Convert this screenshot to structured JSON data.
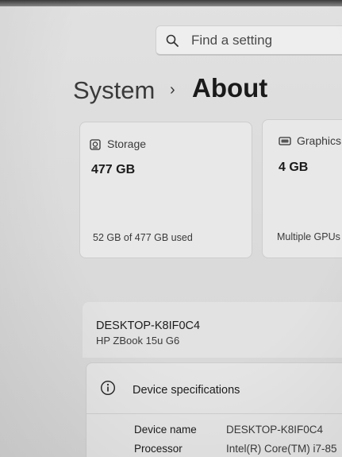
{
  "search": {
    "placeholder": "Find a setting"
  },
  "breadcrumb": {
    "parent": "System",
    "separator": "›",
    "current": "About"
  },
  "cards": {
    "storage": {
      "title": "Storage",
      "value": "477 GB",
      "usage": "52 GB of 477 GB used",
      "icon": "storage-drive-icon"
    },
    "graphics": {
      "title": "Graphics",
      "value": "4 GB",
      "detail": "Multiple GPUs",
      "icon": "display-card-icon"
    }
  },
  "device": {
    "name": "DESKTOP-K8IF0C4",
    "model": "HP ZBook 15u G6"
  },
  "specs": {
    "title": "Device specifications",
    "icon": "info-icon",
    "rows": [
      {
        "label": "Device name",
        "value": "DESKTOP-K8IF0C4"
      },
      {
        "label": "Processor",
        "value": "Intel(R) Core(TM) i7-85"
      }
    ]
  },
  "colors": {
    "background": "#dcdcdc",
    "card": "#e8e8e8",
    "text": "#1c1c1c",
    "muted": "#3a3a3a"
  }
}
